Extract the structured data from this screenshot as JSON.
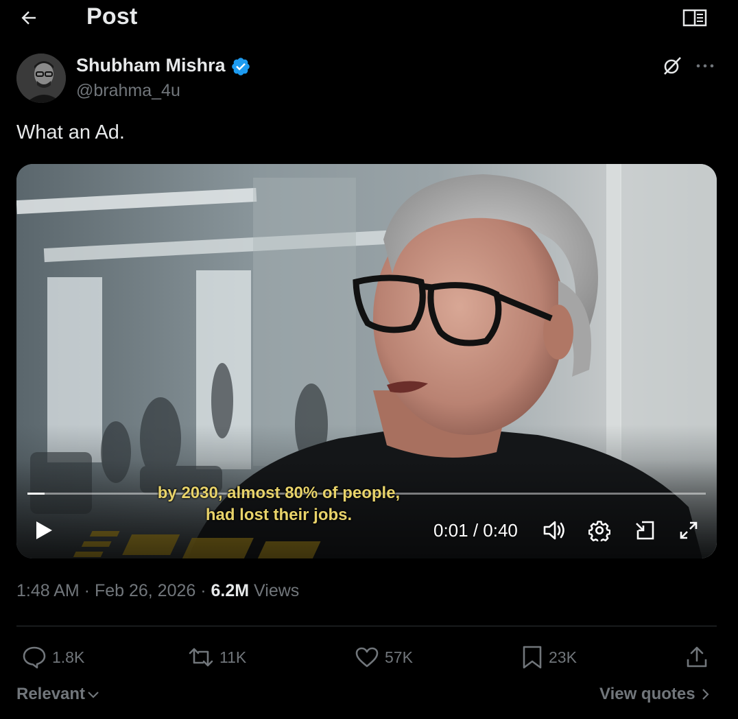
{
  "header": {
    "title": "Post",
    "back_icon": "arrow-left-icon",
    "reader_icon": "book-open-icon"
  },
  "author": {
    "name": "Shubham Mishra",
    "handle": "@brahma_4u",
    "verified": true,
    "verified_color": "#1d9bf0"
  },
  "post": {
    "text": "What an Ad."
  },
  "video": {
    "subtitle_line1": "by 2030, almost 80% of people,",
    "subtitle_line2": "had lost their jobs.",
    "time": "0:01 / 0:40",
    "progress": 0.025,
    "controls": [
      "play-icon",
      "volume-icon",
      "settings-icon",
      "pip-icon",
      "fullscreen-icon"
    ]
  },
  "meta": {
    "timestamp": "1:48 AM · Feb 26, 2026 · ",
    "views_count": "6.2M",
    "views_label": " Views"
  },
  "actions": {
    "replies": "1.8K",
    "reposts": "11K",
    "likes": "57K",
    "bookmarks": "23K"
  },
  "footer": {
    "sort_label": "Relevant",
    "view_quotes_label": "View quotes"
  },
  "colors": {
    "background": "#000000",
    "text": "#e7e9ea",
    "muted": "#71767b",
    "subtitle": "#e8d36a"
  }
}
